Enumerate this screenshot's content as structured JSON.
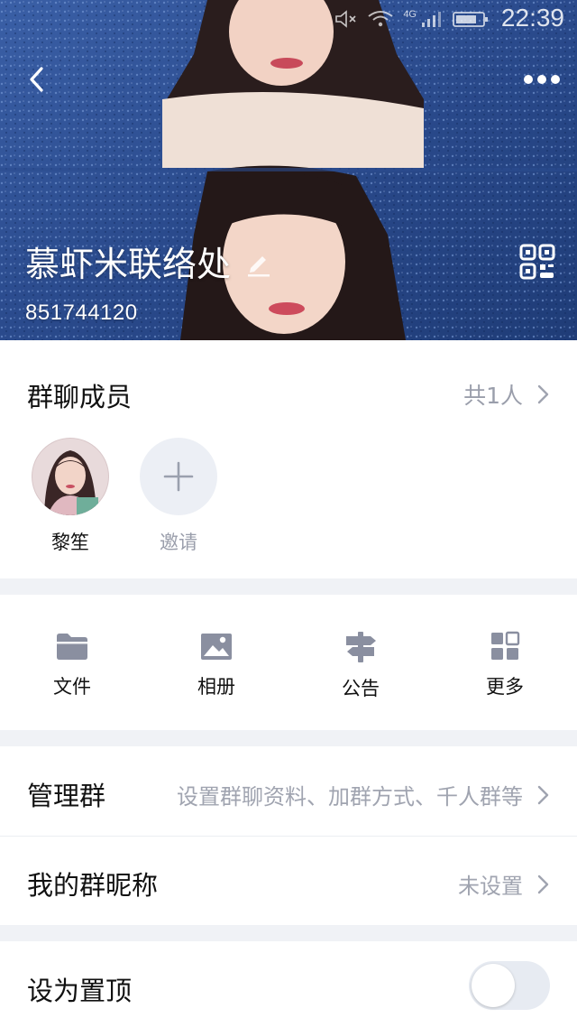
{
  "status_bar": {
    "time": "22:39",
    "network": "4G"
  },
  "header": {
    "group_name": "慕虾米联络处",
    "group_id": "851744120"
  },
  "members": {
    "title": "群聊成员",
    "count_text": "共1人",
    "list": [
      {
        "name": "黎笙"
      }
    ],
    "invite_label": "邀请"
  },
  "tools": [
    {
      "label": "文件",
      "icon": "folder-icon"
    },
    {
      "label": "相册",
      "icon": "photo-icon"
    },
    {
      "label": "公告",
      "icon": "signpost-icon"
    },
    {
      "label": "更多",
      "icon": "grid-icon"
    }
  ],
  "settings": {
    "manage": {
      "title": "管理群",
      "value": "设置群聊资料、加群方式、千人群等"
    },
    "nickname": {
      "title": "我的群昵称",
      "value": "未设置"
    }
  },
  "pin": {
    "title": "设为置顶",
    "enabled": false
  },
  "colors": {
    "accent": "#2c4f93",
    "secondary_text": "#9a9eab",
    "icon_gray": "#8a8fa0"
  }
}
